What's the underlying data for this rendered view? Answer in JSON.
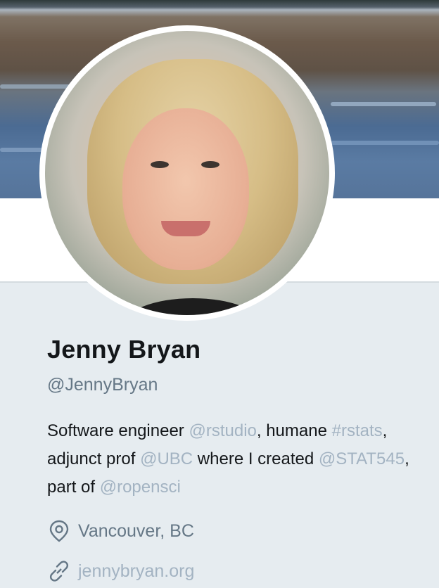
{
  "profile": {
    "name": "Jenny Bryan",
    "handle": "@JennyBryan",
    "bio": [
      {
        "text": "Software engineer ",
        "link": false
      },
      {
        "text": "@rstudio",
        "link": true
      },
      {
        "text": ", humane ",
        "link": false
      },
      {
        "text": "#rstats",
        "link": true
      },
      {
        "text": ", adjunct prof ",
        "link": false
      },
      {
        "text": "@UBC",
        "link": true
      },
      {
        "text": " where I created ",
        "link": false
      },
      {
        "text": "@STAT545",
        "link": true
      },
      {
        "text": ", part of ",
        "link": false
      },
      {
        "text": "@ropensci",
        "link": true
      }
    ],
    "location": "Vancouver, BC",
    "website": "jennybryan.org"
  },
  "icons": {
    "location": "location-pin-icon",
    "website": "link-icon"
  },
  "colors": {
    "background": "#e6ecf0",
    "text": "#14171a",
    "secondary": "#657786",
    "link": "#a3b3c2"
  }
}
